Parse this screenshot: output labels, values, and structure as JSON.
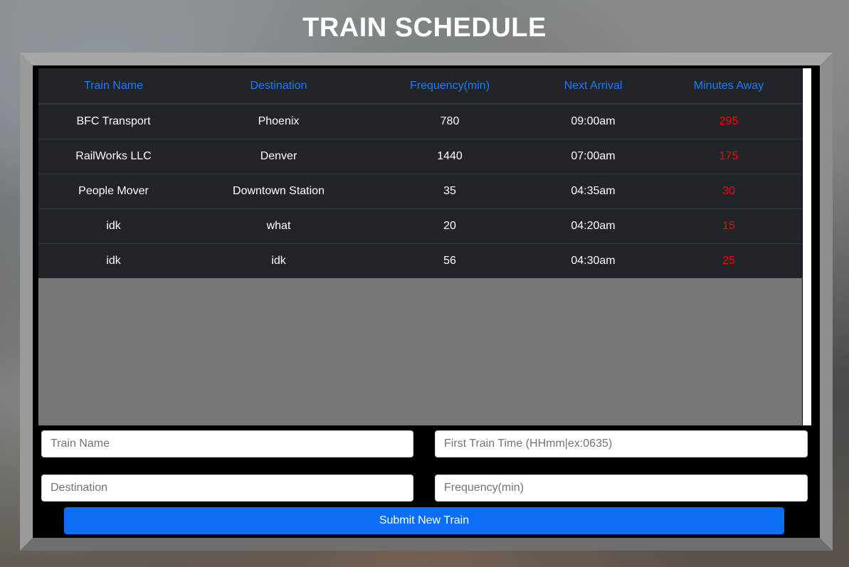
{
  "page": {
    "title": "TRAIN SCHEDULE"
  },
  "table": {
    "headers": [
      "Train Name",
      "Destination",
      "Frequency(min)",
      "Next Arrival",
      "Minutes Away"
    ],
    "rows": [
      {
        "name": "BFC Transport",
        "destination": "Phoenix",
        "frequency": "780",
        "next_arrival": "09:00am",
        "minutes_away": "295"
      },
      {
        "name": "RailWorks LLC",
        "destination": "Denver",
        "frequency": "1440",
        "next_arrival": "07:00am",
        "minutes_away": "175"
      },
      {
        "name": "People Mover",
        "destination": "Downtown Station",
        "frequency": "35",
        "next_arrival": "04:35am",
        "minutes_away": "30"
      },
      {
        "name": "idk",
        "destination": "what",
        "frequency": "20",
        "next_arrival": "04:20am",
        "minutes_away": "15"
      },
      {
        "name": "idk",
        "destination": "idk",
        "frequency": "56",
        "next_arrival": "04:30am",
        "minutes_away": "25"
      }
    ]
  },
  "form": {
    "train_name": {
      "placeholder": "Train Name",
      "value": ""
    },
    "first_train_time": {
      "placeholder": "First Train Time (HHmm|ex:0635)",
      "value": ""
    },
    "destination": {
      "placeholder": "Destination",
      "value": ""
    },
    "frequency": {
      "placeholder": "Frequency(min)",
      "value": ""
    },
    "submit_label": "Submit New Train"
  },
  "colors": {
    "header_text": "#1e7cf2",
    "minutes_away_text": "#ff0000",
    "table_bg": "#212529",
    "submit_bg": "#0a6ff5"
  }
}
